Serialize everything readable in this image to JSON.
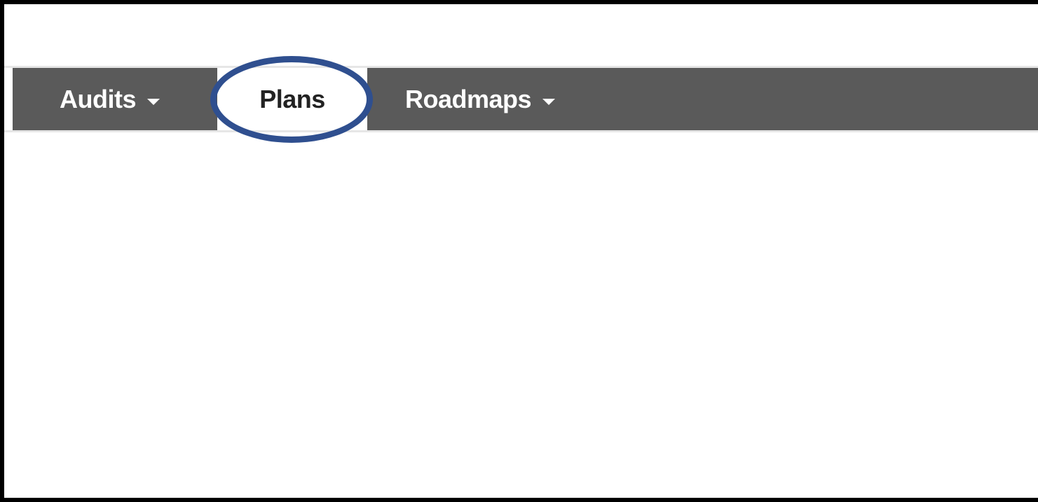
{
  "nav": {
    "items": [
      {
        "label": "Audits",
        "has_dropdown": true,
        "icon": "caret-down-icon"
      },
      {
        "label": "Plans",
        "has_dropdown": false,
        "active": true
      },
      {
        "label": "Roadmaps",
        "has_dropdown": true,
        "icon": "caret-down-icon"
      }
    ]
  },
  "colors": {
    "navbar_bg": "#5a5a5a",
    "nav_text": "#ffffff",
    "active_tab_bg": "#ffffff",
    "active_tab_text": "#222222",
    "highlight_ring": "#2f4f8f",
    "frame_border": "#000000"
  }
}
